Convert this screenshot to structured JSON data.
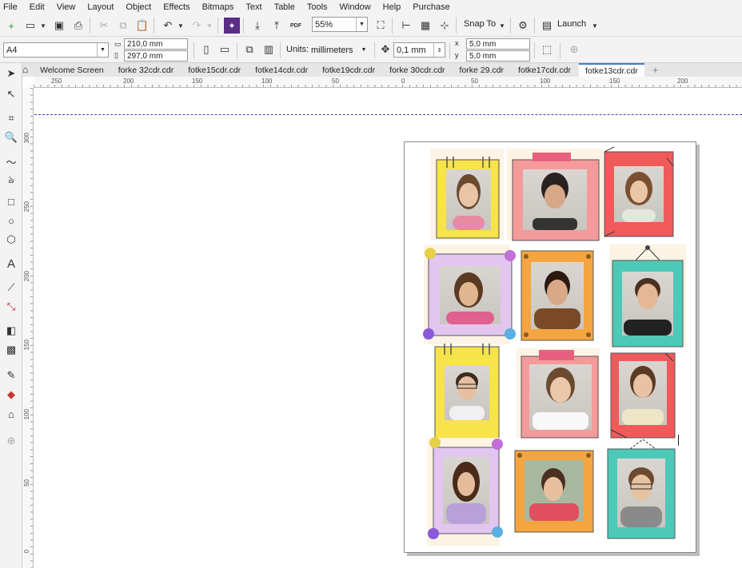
{
  "menu": [
    "File",
    "Edit",
    "View",
    "Layout",
    "Object",
    "Effects",
    "Bitmaps",
    "Text",
    "Table",
    "Tools",
    "Window",
    "Help",
    "Purchase"
  ],
  "toolbar": {
    "zoom": "55%",
    "snap_to": "Snap To",
    "launch": "Launch",
    "pdf_label": "PDF"
  },
  "property_bar": {
    "page_size": "A4",
    "width": "210,0 mm",
    "height": "297,0 mm",
    "units_label": "Units:",
    "units": "millimeters",
    "nudge": "0,1 mm",
    "dup_x": "5,0 mm",
    "dup_y": "5,0 mm"
  },
  "tabs": [
    "Welcome Screen",
    "forke 32cdr.cdr",
    "fotke15cdr.cdr",
    "fotke14cdr.cdr",
    "fotke19cdr.cdr",
    "forke 30cdr.cdr",
    "forke 29.cdr",
    "fotke17cdr.cdr",
    "fotke13cdr.cdr"
  ],
  "active_tab": "fotke13cdr.cdr",
  "ruler_h": [
    "250",
    "200",
    "150",
    "100",
    "50",
    "0",
    "50",
    "100",
    "150",
    "200"
  ],
  "ruler_v": [
    "300",
    "250",
    "200",
    "150",
    "100",
    "50",
    "0"
  ],
  "colors": {
    "accent": "#3b82c4",
    "yellow": "#f7e34a",
    "pink": "#f59a9a",
    "red": "#f05a5a",
    "purple": "#e2c6f0",
    "orange": "#f5a540",
    "teal": "#4ec9b8"
  }
}
